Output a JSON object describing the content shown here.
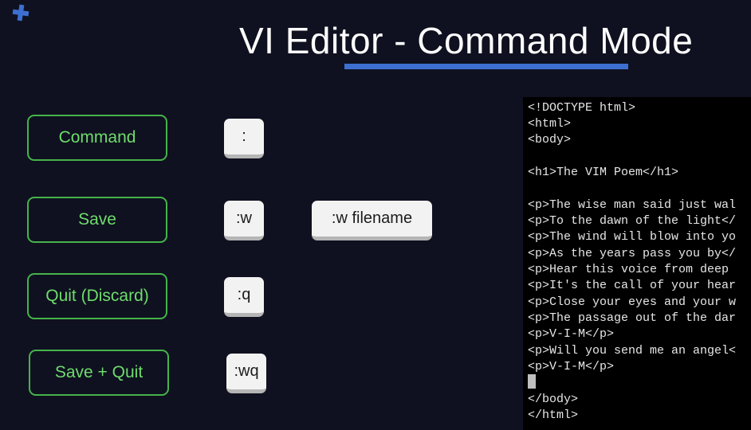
{
  "title": "VI Editor - Command Mode",
  "rows": [
    {
      "label": "Command",
      "keys": [
        ":"
      ]
    },
    {
      "label": "Save",
      "keys": [
        ":w",
        ":w filename"
      ]
    },
    {
      "label": "Quit (Discard)",
      "keys": [
        ":q"
      ]
    },
    {
      "label": "Save + Quit",
      "keys": [
        ":wq"
      ]
    }
  ],
  "terminal": {
    "lines": [
      "<!DOCTYPE html>",
      "<html>",
      "<body>",
      "",
      "<h1>The VIM Poem</h1>",
      "",
      "<p>The wise man said just wal",
      "<p>To the dawn of the light</",
      "<p>The wind will blow into yo",
      "<p>As the years pass you by</",
      "<p>Hear this voice from deep ",
      "<p>It's the call of your hear",
      "<p>Close your eyes and your w",
      "<p>The passage out of the dar",
      "<p>V-I-M</p>",
      "<p>Will you send me an angel<",
      "<p>V-I-M</p>",
      "",
      "</body>",
      "</html>"
    ]
  },
  "colors": {
    "background": "#0f1120",
    "accent_blue": "#3d6fd1",
    "box_border_green": "#46b34b",
    "box_text_green": "#6fdc6c"
  },
  "icons": {
    "top_left": "plus-icon"
  }
}
